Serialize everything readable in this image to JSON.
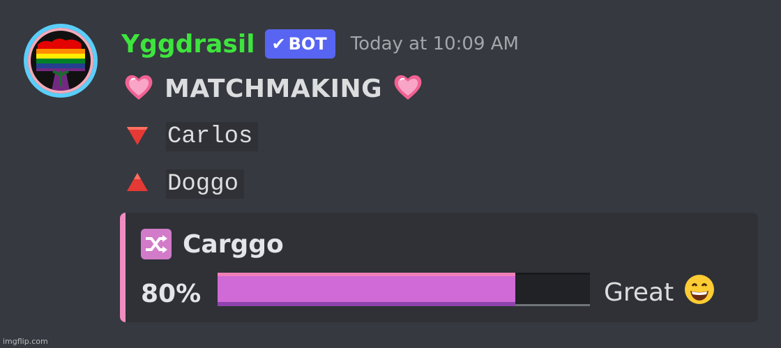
{
  "message": {
    "author": "Yggdrasil",
    "bot_tag": "BOT",
    "bot_check": "✔",
    "timestamp": "Today at 10:09 AM",
    "title": "MATCHMAKING",
    "person1": "Carlos",
    "person2": "Doggo"
  },
  "embed": {
    "title": "Carggo",
    "percent_label": "80%",
    "percent_value": 0.8,
    "rating": "Great",
    "accent_color": "#f08cc2",
    "icon": "shuffle-icon"
  },
  "colors": {
    "username": "#3ee43e",
    "bot_badge": "#5865f2",
    "background": "#36393f"
  },
  "icons": {
    "title_left": "heart-icon",
    "title_right": "heart-icon",
    "person1_marker": "red-down-triangle-icon",
    "person2_marker": "red-up-triangle-icon",
    "rating_emoji": "grinning-face-icon"
  },
  "watermark": "imgflip.com"
}
